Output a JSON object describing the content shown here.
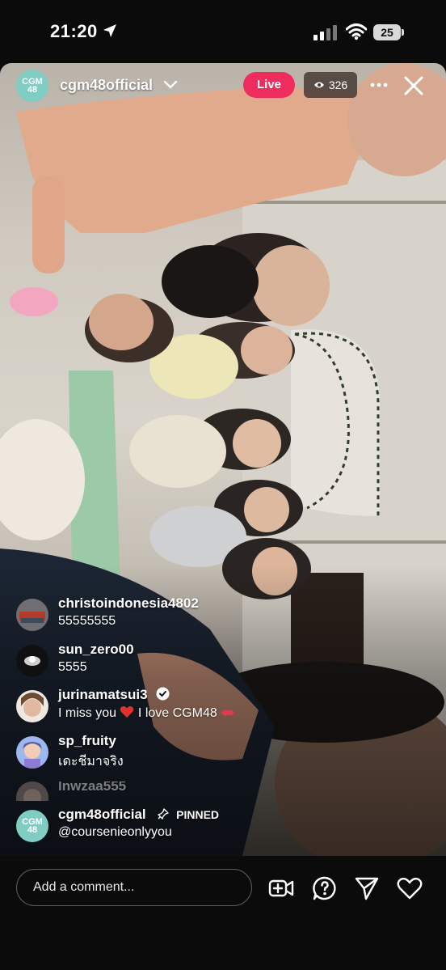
{
  "status_bar": {
    "time": "21:20",
    "battery": "25"
  },
  "header": {
    "avatar_text": "CGM 48",
    "host_name": "cgm48official",
    "live_label": "Live",
    "viewer_count": "326"
  },
  "comments": [
    {
      "user": "christoindonesia4802",
      "text": "55555555"
    },
    {
      "user": "sun_zero00",
      "text": "5555"
    },
    {
      "user": "jurinamatsui3",
      "text": "I miss you",
      "text_2": "I love CGM48",
      "verified": true
    },
    {
      "user": "sp_fruity",
      "text": "เดะชีมาจริง"
    },
    {
      "user": "lnwzaa555",
      "text": ""
    }
  ],
  "pinned": {
    "user": "cgm48official",
    "tag": "PINNED",
    "text": "@coursenieonlyyou"
  },
  "composer": {
    "placeholder": "Add a comment..."
  },
  "icons": [
    "location-arrow-icon",
    "signal-icon",
    "wifi-icon",
    "chevron-down-icon",
    "eye-icon",
    "more-icon",
    "close-icon",
    "verified-icon",
    "pin-icon",
    "add-video-icon",
    "question-icon",
    "send-icon",
    "heart-icon"
  ],
  "colors": {
    "live": "#ee2c5d",
    "brand_teal": "#7fcdc3",
    "background": "#0b0b0c"
  }
}
